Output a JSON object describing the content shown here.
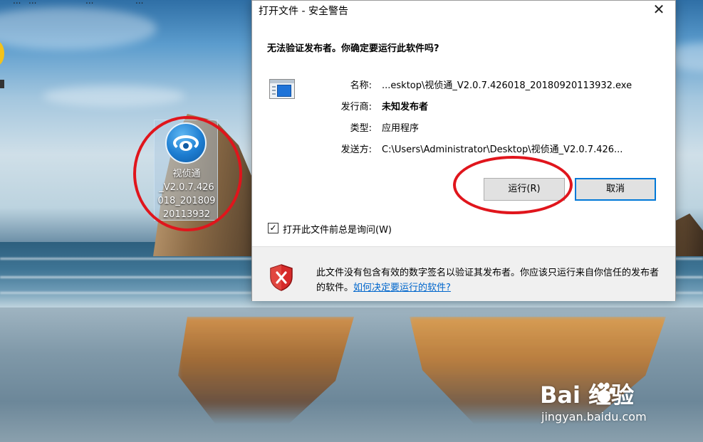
{
  "desktop": {
    "taskbar_fragment": [
      "...",
      "...",
      "...",
      "..."
    ],
    "selected_icon": {
      "label_lines": [
        "视侦通",
        "_V2.0.7.426",
        "018_201809",
        "20113932"
      ],
      "icon": "eye-app-icon"
    }
  },
  "dialog": {
    "title": "打开文件 - 安全警告",
    "close_glyph": "✕",
    "heading": "无法验证发布者。你确定要运行此软件吗?",
    "rows": [
      {
        "label": "名称:",
        "value": "...esktop\\视侦通_V2.0.7.426018_20180920113932.exe"
      },
      {
        "label": "发行商:",
        "value": "未知发布者"
      },
      {
        "label": "类型:",
        "value": "应用程序"
      },
      {
        "label": "发送方:",
        "value": "C:\\Users\\Administrator\\Desktop\\视侦通_V2.0.7.426..."
      }
    ],
    "run_button": "运行(R)",
    "cancel_button": "取消",
    "ask_checkbox": {
      "checked": true,
      "glyph": "✓",
      "label": "打开此文件前总是询问(W)"
    },
    "footer": {
      "text": "此文件没有包含有效的数字签名以验证其发布者。你应该只运行来自你信任的发布者的软件。",
      "link": "如何决定要运行的软件?"
    }
  },
  "watermark": {
    "brand": "Bai 经验",
    "url": "jingyan.baidu.com"
  },
  "colors": {
    "annotation_red": "#e0151c",
    "link_blue": "#0066cc",
    "focus_blue": "#0078d7"
  }
}
